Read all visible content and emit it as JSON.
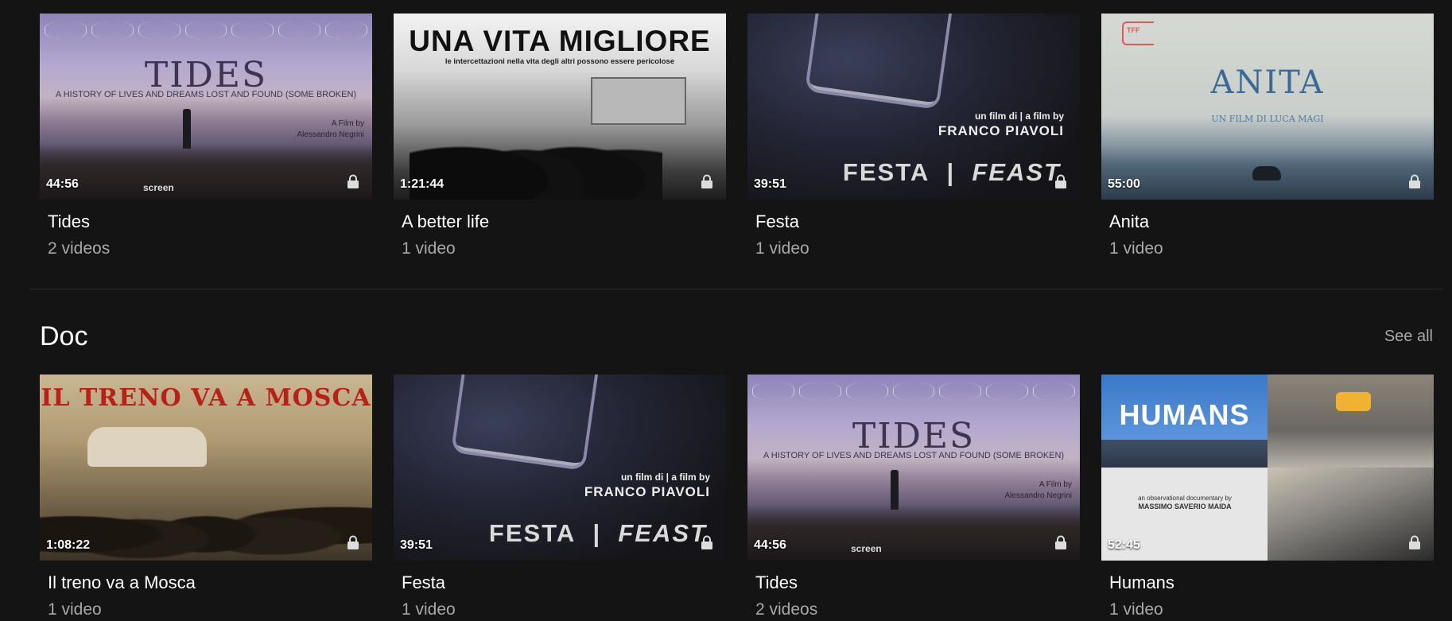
{
  "top_row": [
    {
      "title": "Tides",
      "subtitle": "2 videos",
      "duration": "44:56",
      "art": "tides"
    },
    {
      "title": "A better life",
      "subtitle": "1 video",
      "duration": "1:21:44",
      "art": "vita"
    },
    {
      "title": "Festa",
      "subtitle": "1 video",
      "duration": "39:51",
      "art": "festa"
    },
    {
      "title": "Anita",
      "subtitle": "1 video",
      "duration": "55:00",
      "art": "anita"
    }
  ],
  "section": {
    "title": "Doc",
    "see_all": "See all"
  },
  "doc_row": [
    {
      "title": "Il treno va a Mosca",
      "subtitle": "1 video",
      "duration": "1:08:22",
      "art": "treno"
    },
    {
      "title": "Festa",
      "subtitle": "1 video",
      "duration": "39:51",
      "art": "festa"
    },
    {
      "title": "Tides",
      "subtitle": "2 videos",
      "duration": "44:56",
      "art": "tides"
    },
    {
      "title": "Humans",
      "subtitle": "1 video",
      "duration": "52:45",
      "art": "humans"
    }
  ],
  "art_text": {
    "tides": {
      "title": "TIDES",
      "subtitle": "A HISTORY OF LIVES AND DREAMS LOST AND FOUND (SOME BROKEN)",
      "credit_line1": "A Film by",
      "credit_line2": "Alessandro Negrini",
      "logo": "screen"
    },
    "vita": {
      "title": "UNA VITA MIGLIORE",
      "subtitle": "le intercettazioni nella vita degli altri possono essere pericolose"
    },
    "festa": {
      "credit_line1": "un film di  | a film by",
      "credit_line2": "FRANCO PIAVOLI",
      "title_a": "FESTA",
      "title_sep": "|",
      "title_b": "FEAST"
    },
    "anita": {
      "title": "ANITA",
      "subtitle": "UN FILM DI LUCA MAGI",
      "badge": "TFF"
    },
    "treno": {
      "title": "IL TRENO VA A MOSCA"
    },
    "humans": {
      "title": "HUMANS",
      "credits_line1": "an observational documentary by",
      "credits_line2": "MASSIMO SAVERIO MAIDA"
    }
  },
  "colors": {
    "background": "#141414",
    "text": "#ffffff",
    "muted": "#a8a8a8"
  },
  "icons": {
    "lock": "lock-icon"
  }
}
